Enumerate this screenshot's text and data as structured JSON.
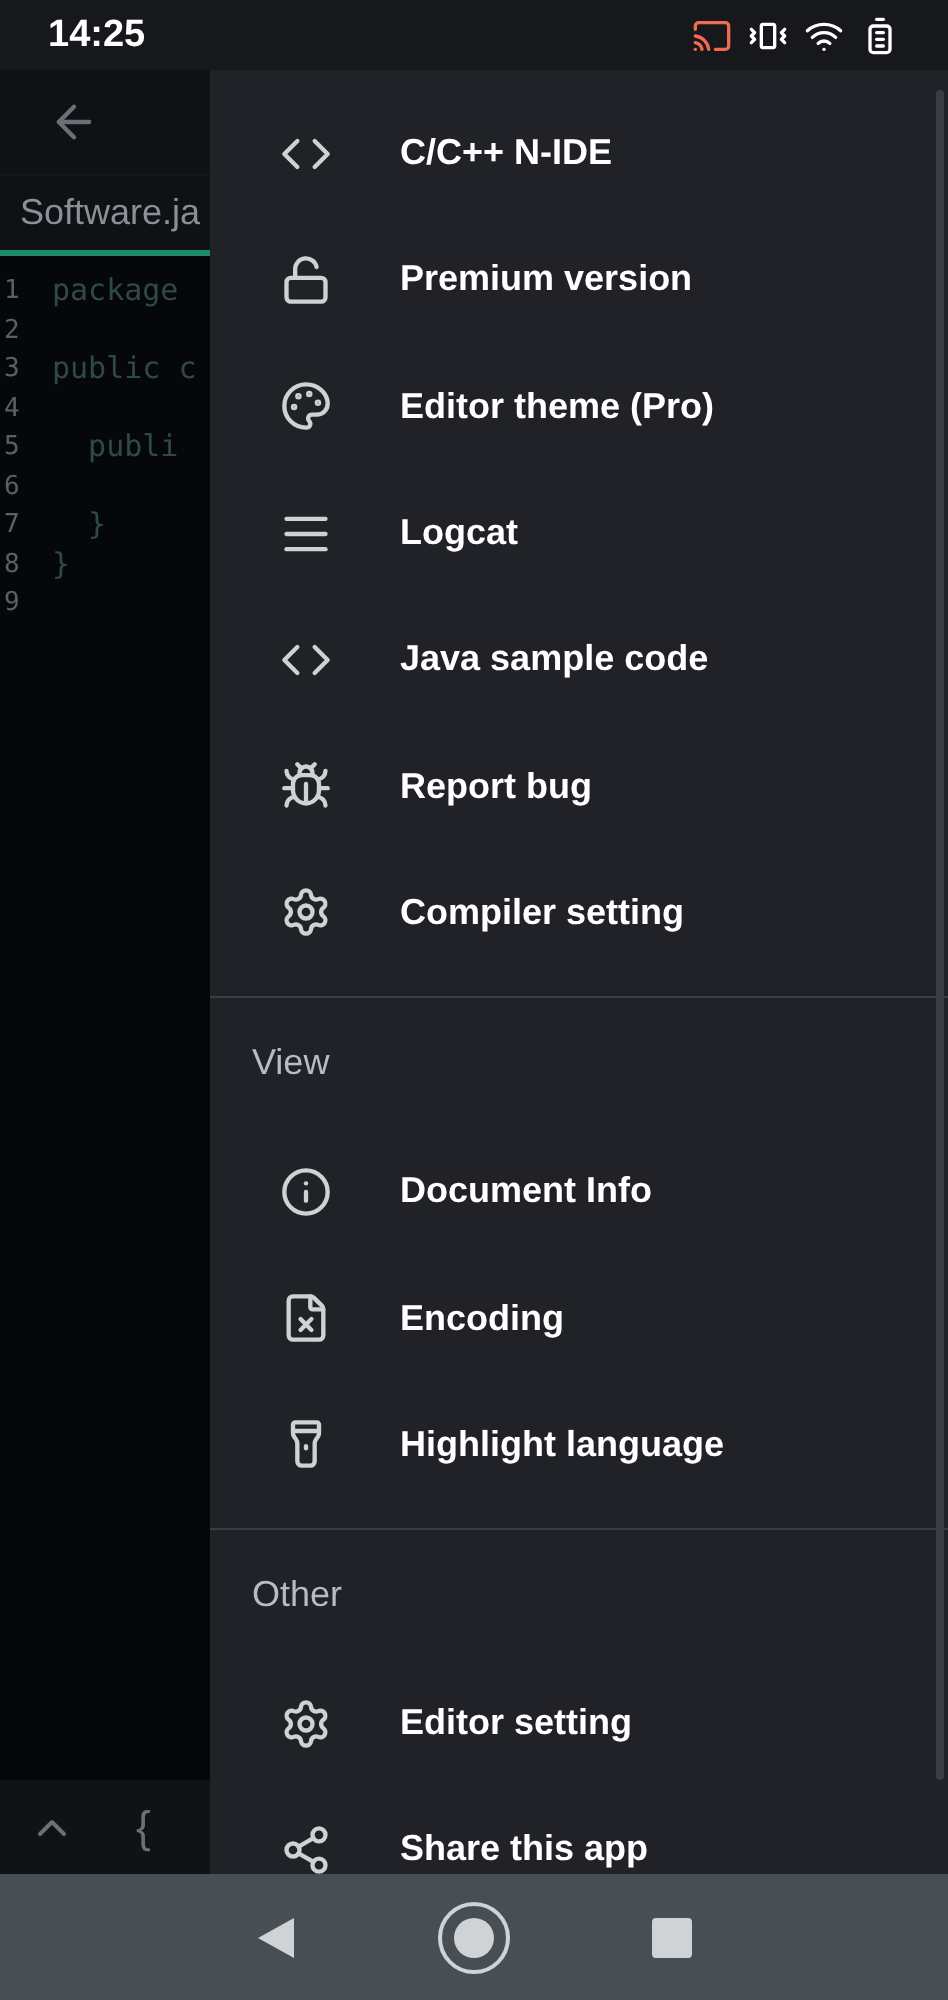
{
  "status_bar": {
    "time": "14:25"
  },
  "editor": {
    "tab": "Software.ja",
    "lines": [
      {
        "number": "1",
        "text": "package"
      },
      {
        "number": "2"
      },
      {
        "number": "3",
        "text": "public c"
      },
      {
        "number": "4"
      },
      {
        "number": "5",
        "text": "  publi"
      },
      {
        "number": "6"
      },
      {
        "number": "7",
        "text": "  }"
      },
      {
        "number": "8",
        "text": "}"
      },
      {
        "number": "9"
      }
    ],
    "key_bar": {
      "brace": "{"
    }
  },
  "drawer": {
    "sections": [
      {
        "items": [
          {
            "kind": "code",
            "label": "C/C++ N-IDE"
          },
          {
            "kind": "lock",
            "label": "Premium version"
          },
          {
            "kind": "palette",
            "label": "Editor theme (Pro)"
          },
          {
            "kind": "lines",
            "label": "Logcat"
          },
          {
            "kind": "code",
            "label": "Java sample code"
          },
          {
            "kind": "bug",
            "label": "Report bug"
          },
          {
            "kind": "gear",
            "label": "Compiler setting"
          }
        ]
      },
      {
        "title": "View",
        "items": [
          {
            "kind": "info",
            "label": "Document Info"
          },
          {
            "kind": "file",
            "label": "Encoding"
          },
          {
            "kind": "flashlight",
            "label": "Highlight language"
          }
        ]
      },
      {
        "title": "Other",
        "items": [
          {
            "kind": "gear",
            "label": "Editor setting"
          },
          {
            "kind": "share",
            "label": "Share this app"
          }
        ]
      }
    ]
  }
}
